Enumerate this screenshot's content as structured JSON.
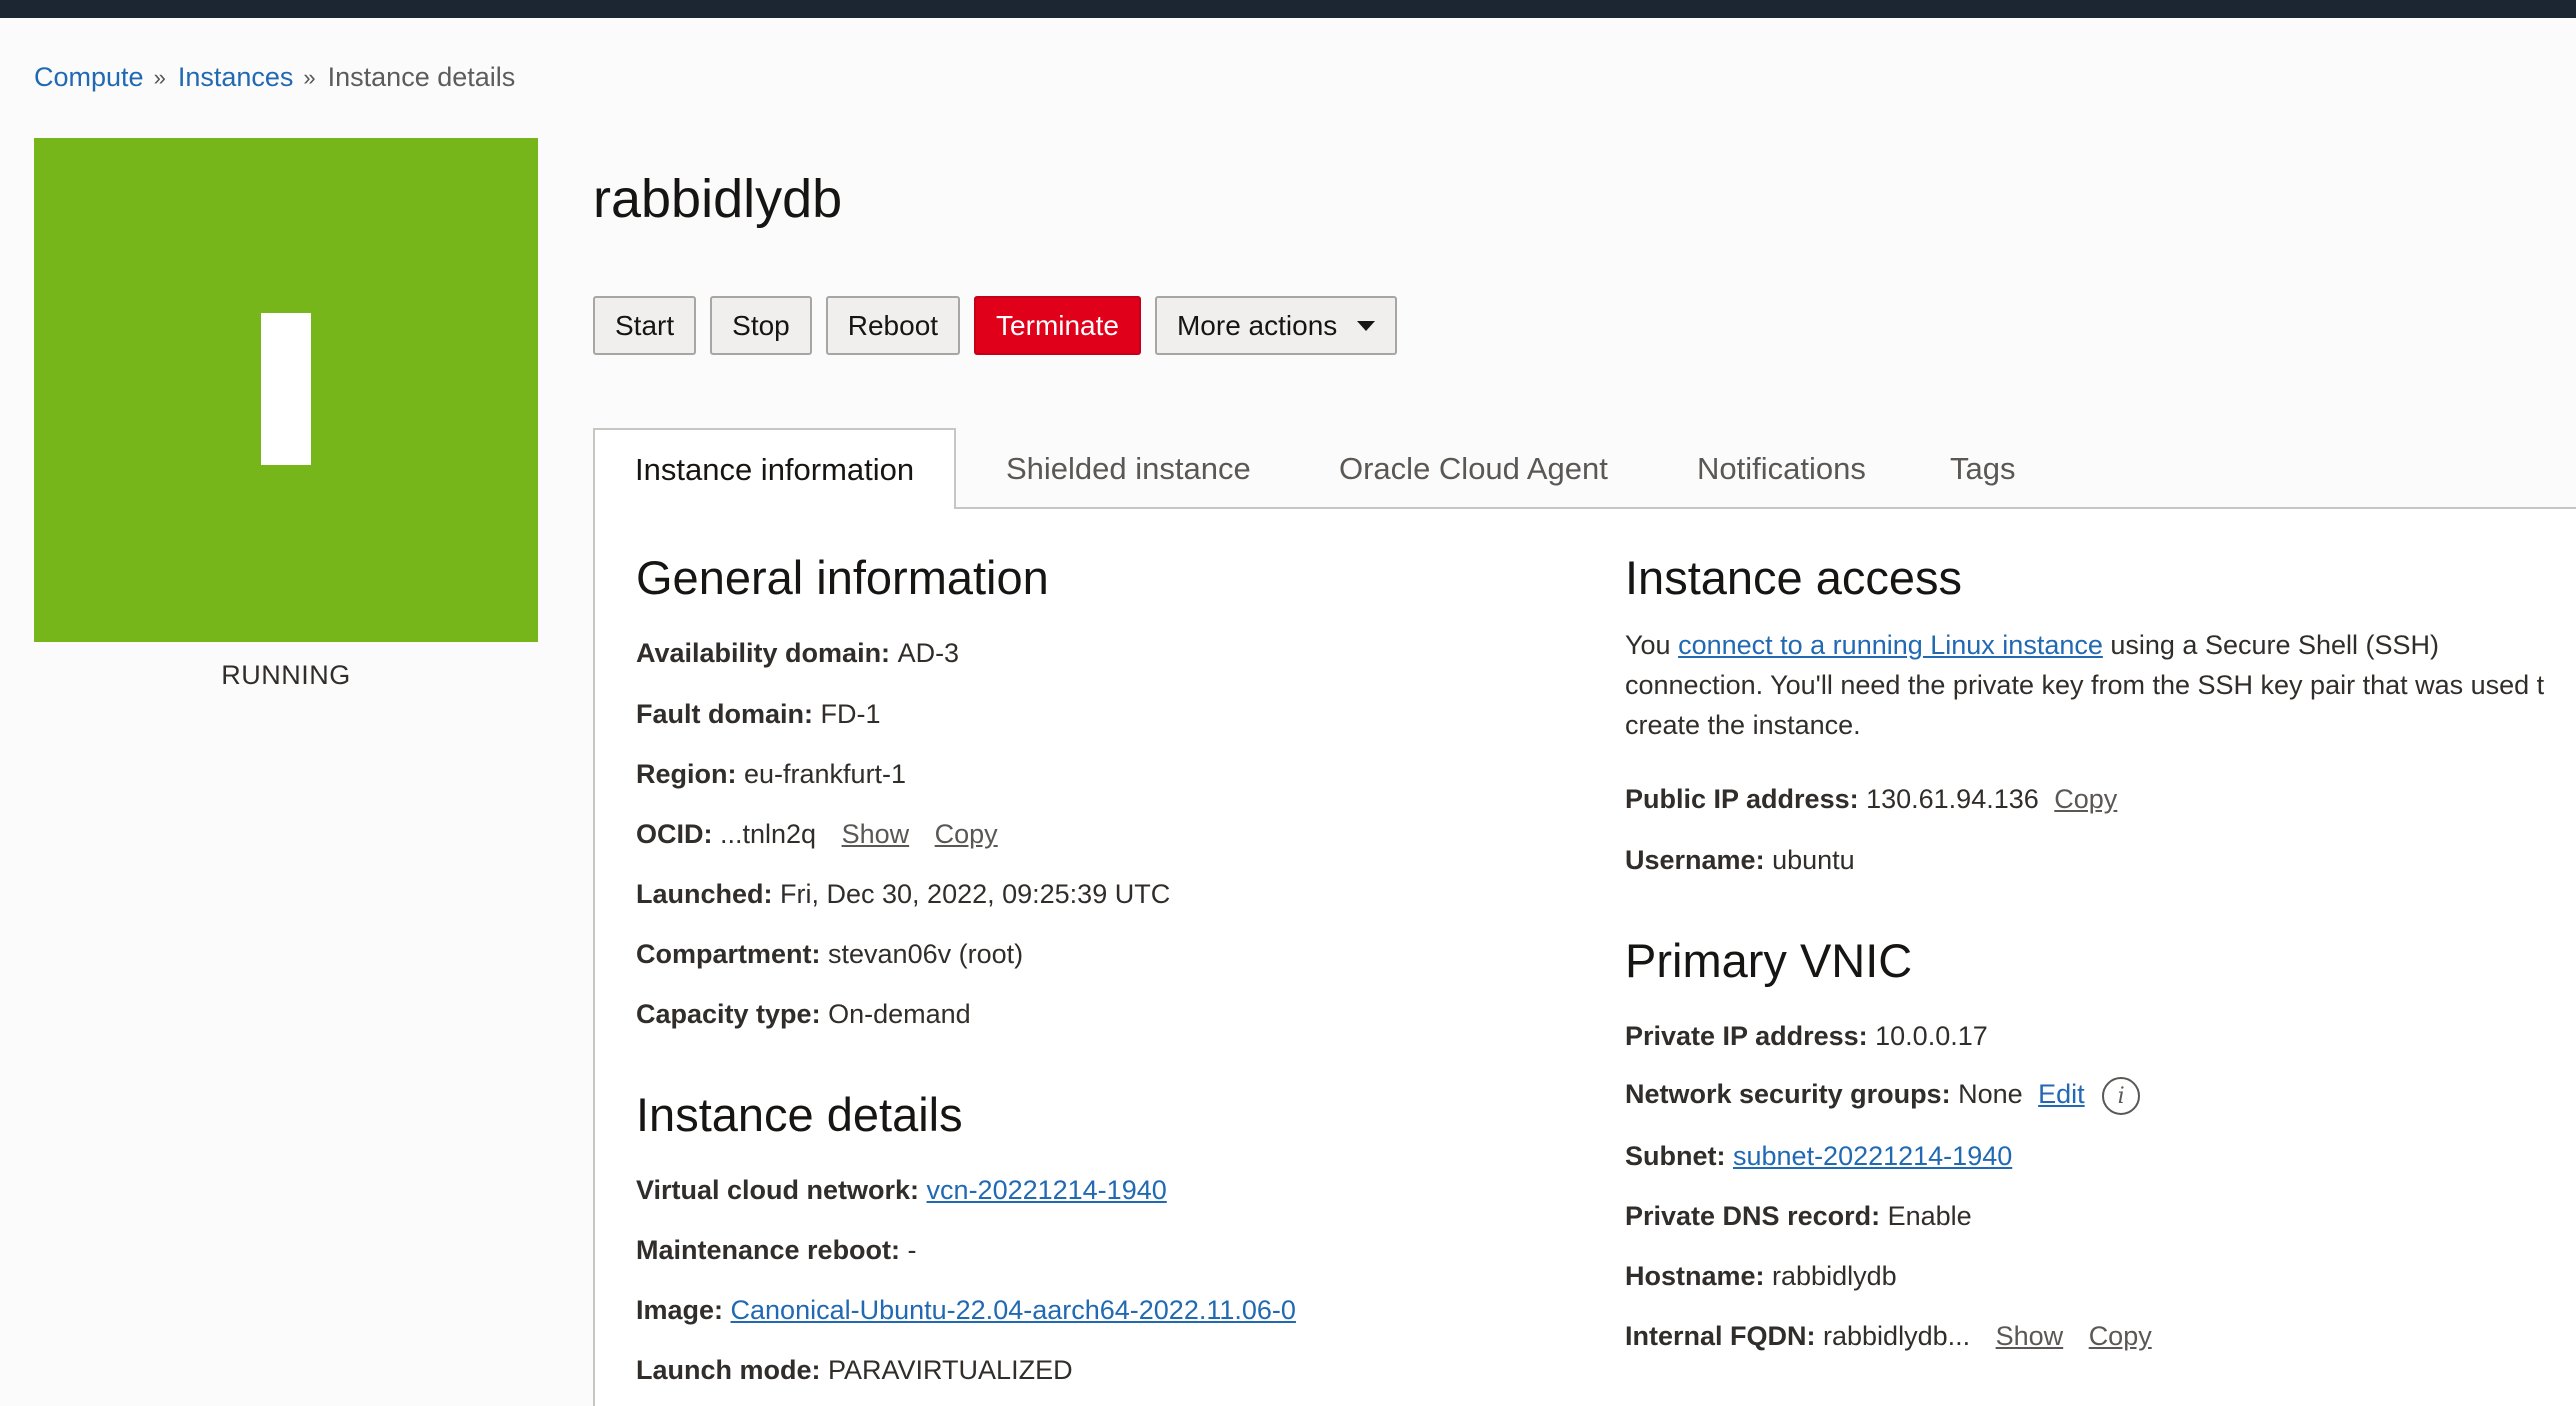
{
  "breadcrumb": {
    "compute": "Compute",
    "instances": "Instances",
    "current": "Instance details",
    "separator": "»"
  },
  "status": {
    "label": "RUNNING",
    "color": "#76b61b"
  },
  "instance": {
    "name": "rabbidlydb"
  },
  "actions": {
    "start": "Start",
    "stop": "Stop",
    "reboot": "Reboot",
    "terminate": "Terminate",
    "more": "More actions"
  },
  "tabs": [
    "Instance information",
    "Shielded instance",
    "Oracle Cloud Agent",
    "Notifications",
    "Tags"
  ],
  "general": {
    "title": "General information",
    "availability_domain": {
      "label": "Availability domain:",
      "value": "AD-3"
    },
    "fault_domain": {
      "label": "Fault domain:",
      "value": "FD-1"
    },
    "region": {
      "label": "Region:",
      "value": "eu-frankfurt-1"
    },
    "ocid": {
      "label": "OCID:",
      "value": "...tnln2q",
      "show": "Show",
      "copy": "Copy"
    },
    "launched": {
      "label": "Launched:",
      "value": "Fri, Dec 30, 2022, 09:25:39 UTC"
    },
    "compartment": {
      "label": "Compartment:",
      "value": "stevan06v (root)"
    },
    "capacity_type": {
      "label": "Capacity type:",
      "value": "On-demand"
    }
  },
  "details": {
    "title": "Instance details",
    "vcn": {
      "label": "Virtual cloud network:",
      "value": "vcn-20221214-1940"
    },
    "maintenance": {
      "label": "Maintenance reboot:",
      "value": "-"
    },
    "image": {
      "label": "Image:",
      "value": "Canonical-Ubuntu-22.04-aarch64-2022.11.06-0"
    },
    "launch_mode": {
      "label": "Launch mode:",
      "value": "PARAVIRTUALIZED"
    }
  },
  "access": {
    "title": "Instance access",
    "text_before": "You ",
    "link": "connect to a running Linux instance",
    "text_line1_after": " using a Secure Shell (SSH)",
    "text_line2": "connection. You'll need the private key from the SSH key pair that was used t",
    "text_line3": "create the instance.",
    "public_ip": {
      "label": "Public IP address:",
      "value": "130.61.94.136",
      "copy": "Copy"
    },
    "username": {
      "label": "Username:",
      "value": "ubuntu"
    }
  },
  "vnic": {
    "title": "Primary VNIC",
    "private_ip": {
      "label": "Private IP address:",
      "value": "10.0.0.17"
    },
    "nsg": {
      "label": "Network security groups:",
      "value": "None",
      "edit": "Edit",
      "info": "i"
    },
    "subnet": {
      "label": "Subnet:",
      "value": "subnet-20221214-1940"
    },
    "dns": {
      "label": "Private DNS record:",
      "value": "Enable"
    },
    "hostname": {
      "label": "Hostname:",
      "value": "rabbidlydb"
    },
    "fqdn": {
      "label": "Internal FQDN:",
      "value": "rabbidlydb...",
      "show": "Show",
      "copy": "Copy"
    }
  }
}
